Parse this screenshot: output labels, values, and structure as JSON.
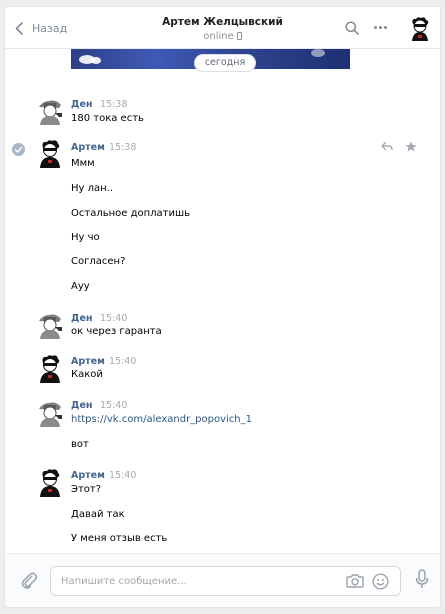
{
  "header": {
    "back_label": "Назад",
    "title": "Артем Желцывский",
    "status": "online"
  },
  "date_pill": "сегодня",
  "messages": [
    {
      "author": "Ден",
      "time": "15:38",
      "lines": [
        "180 тока есть"
      ],
      "avatar": "detective-avatar"
    },
    {
      "author": "Артем",
      "time": "15:38",
      "lines": [
        "Ммм",
        "Ну лан..",
        "Остальное доплатишь",
        "Ну чо",
        "Согласен?",
        "Ауу"
      ],
      "avatar": "masked-avatar"
    },
    {
      "author": "Ден",
      "time": "15:40",
      "lines": [
        "ок через гаранта"
      ],
      "avatar": "detective-avatar"
    },
    {
      "author": "Артем",
      "time": "15:40",
      "lines": [
        "Какой"
      ],
      "avatar": "masked-avatar"
    },
    {
      "author": "Ден",
      "time": "15:40",
      "lines": [
        "https://vk.com/alexandr_popovich_1",
        "вот"
      ],
      "avatar": "detective-avatar"
    },
    {
      "author": "Артем",
      "time": "15:40",
      "lines": [
        "Этот?",
        "Давай так",
        "У меня отзыв есть"
      ],
      "avatar": "masked-avatar"
    }
  ],
  "composer": {
    "placeholder": "Напишите сообщение..."
  },
  "icons": {
    "back": "chevron-left-icon",
    "search": "search-icon",
    "more": "more-dots-icon",
    "attach": "paperclip-icon",
    "camera": "camera-icon",
    "emoji": "smile-icon",
    "voice": "microphone-icon",
    "reply": "reply-icon",
    "star": "star-icon"
  },
  "colors": {
    "author": "#42648b",
    "link": "#2a5885",
    "time": "#a5abb2",
    "background": "#edeef0"
  }
}
